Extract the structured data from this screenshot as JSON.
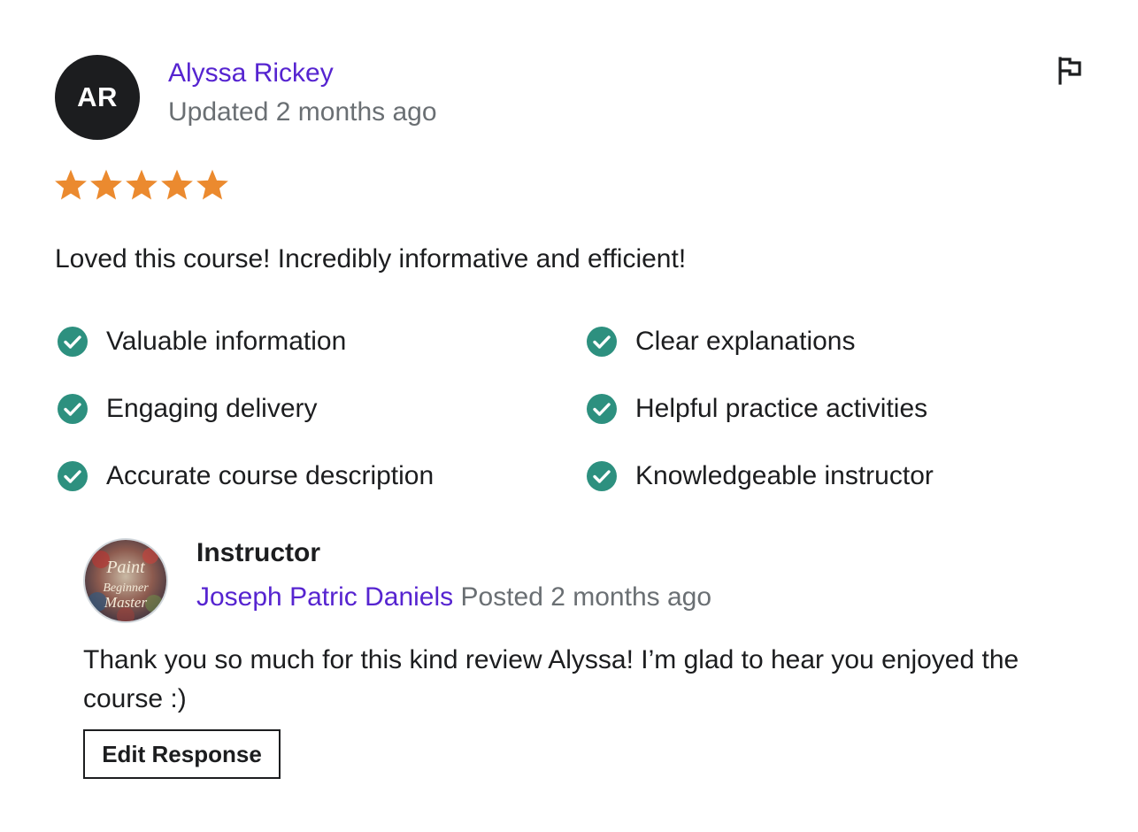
{
  "reviewer": {
    "initials": "AR",
    "name": "Alyssa Rickey",
    "time": "Updated 2 months ago"
  },
  "rating": {
    "stars": 5,
    "max": 5,
    "star_color": "#eb8a2f"
  },
  "review_text": "Loved this course! Incredibly informative and efficient!",
  "attributes": [
    "Valuable information",
    "Clear explanations",
    "Engaging delivery",
    "Helpful practice activities",
    "Accurate course description",
    "Knowledgeable instructor"
  ],
  "response": {
    "role": "Instructor",
    "name": "Joseph Patric Daniels",
    "time": "Posted 2 months ago",
    "avatar_text": [
      "Paint",
      "Beginner",
      "Master"
    ],
    "text": "Thank you so much for this kind review Alyssa! I’m glad to hear you enjoyed the course :)",
    "edit_label": "Edit Response"
  },
  "colors": {
    "link": "#5624d0",
    "muted": "#6a6f73",
    "check": "#2d907f",
    "text": "#1c1d1f"
  },
  "icons": {
    "flag": "flag-icon",
    "check": "check-circle-icon",
    "star": "star-icon"
  }
}
